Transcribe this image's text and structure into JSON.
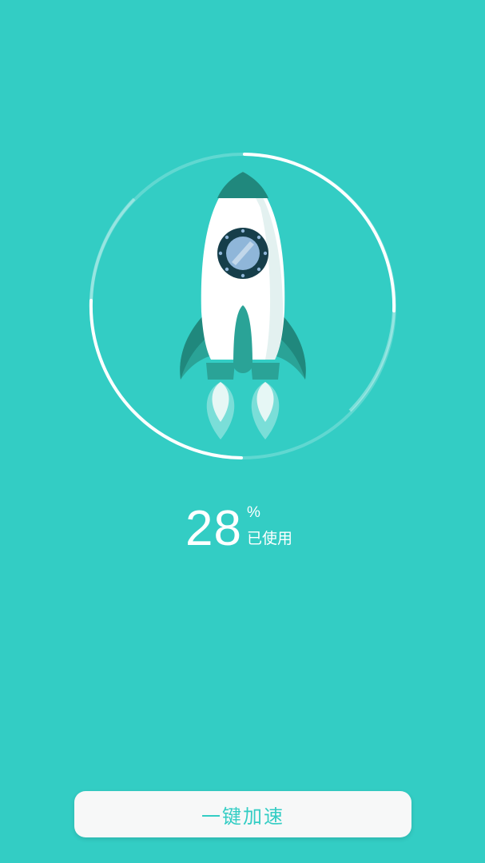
{
  "usage": {
    "value": "28",
    "unit": "%",
    "label": "已使用",
    "fraction": 0.28
  },
  "actions": {
    "boost_label": "一键加速"
  },
  "colors": {
    "background": "#33cdc4",
    "ring_bright": "#ffffff",
    "rocket_body": "#ffffff",
    "rocket_dark": "#20887d",
    "rocket_mid": "#2aa397",
    "window_frame": "#163e4a",
    "window_glass": "#8fb6d9",
    "flame": "#e6f7f5",
    "button_bg": "#f7f8f8",
    "button_text": "#33cdc4"
  },
  "icons": {
    "illustration": "rocket-icon"
  }
}
